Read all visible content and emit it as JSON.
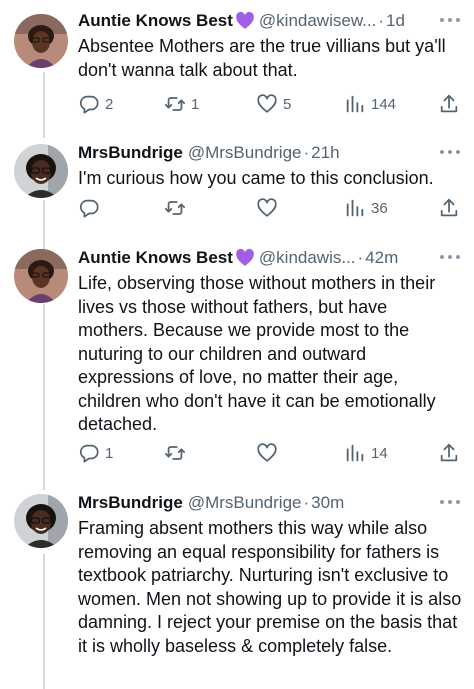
{
  "tweets": [
    {
      "name": "Auntie Knows Best",
      "has_heart": true,
      "handle": "@kindawisew...",
      "dot": "·",
      "time": "1d",
      "text": "Absentee Mothers are the true villians but ya'll don't wanna talk about that.",
      "replies": "2",
      "retweets": "1",
      "likes": "5",
      "views": "144"
    },
    {
      "name": "MrsBundrige",
      "has_heart": false,
      "handle": "@MrsBundrige",
      "dot": "·",
      "time": "21h",
      "text": "I'm curious how you came to this conclusion.",
      "replies": "",
      "retweets": "",
      "likes": "",
      "views": "36"
    },
    {
      "name": "Auntie Knows Best",
      "has_heart": true,
      "handle": "@kindawis...",
      "dot": "·",
      "time": "42m",
      "text": "Life, observing those without mothers in their lives vs those without fathers, but have mothers. Because we provide most to the nuturing to our children and outward expressions of love, no matter their age, children who don't have it can be emotionally detached.",
      "replies": "1",
      "retweets": "",
      "likes": "",
      "views": "14"
    },
    {
      "name": "MrsBundrige",
      "has_heart": false,
      "handle": "@MrsBundrige",
      "dot": "·",
      "time": "30m",
      "text": "Framing absent mothers this way while also removing an equal responsibility for fathers is textbook patriarchy. Nurturing isn't exclusive to women. Men not showing up to provide it is also damning. I reject your premise on the basis that it is wholly baseless & completely false.",
      "replies": "",
      "retweets": "",
      "likes": "",
      "views": ""
    }
  ],
  "icons": {
    "reply": "reply-icon",
    "retweet": "retweet-icon",
    "like": "heart-icon",
    "views": "views-icon",
    "share": "share-icon",
    "more": "more-icon",
    "name_emoji": "purple-heart-icon"
  },
  "colors": {
    "text": "#0f1419",
    "secondary": "#536471",
    "thread_line": "#cfd9de",
    "purple_heart": "#a35ce6"
  }
}
